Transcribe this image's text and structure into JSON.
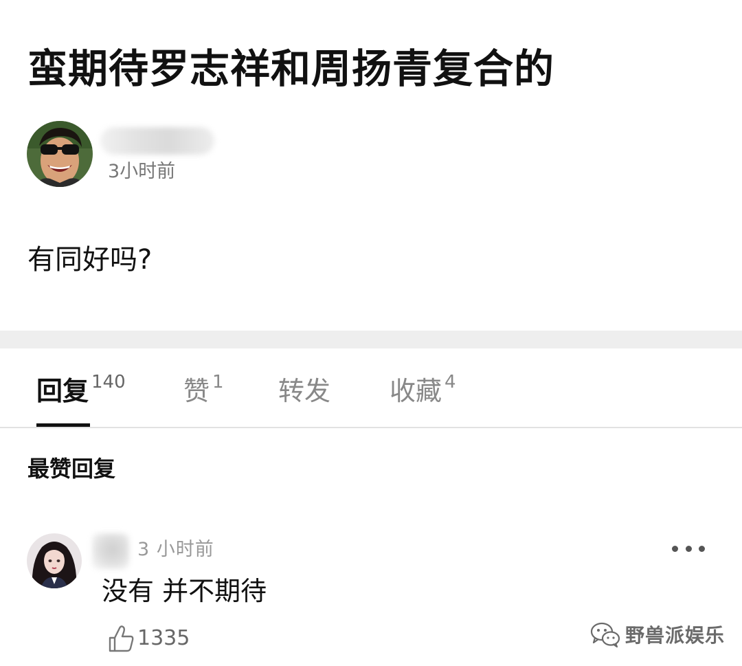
{
  "post": {
    "title": "蛮期待罗志祥和周扬青复合的",
    "author_time": "3小时前",
    "body": "有同好吗?"
  },
  "tabs": [
    {
      "label": "回复",
      "count": "140",
      "active": true
    },
    {
      "label": "赞",
      "count": "1",
      "active": false
    },
    {
      "label": "转发",
      "count": "",
      "active": false
    },
    {
      "label": "收藏",
      "count": "4",
      "active": false
    }
  ],
  "section": {
    "heading": "最赞回复"
  },
  "comment": {
    "time": "3 小时前",
    "text": "没有 并不期待",
    "likes": "1335"
  },
  "watermark": {
    "text": "野兽派娱乐",
    "icon": "wechat-icon"
  },
  "colors": {
    "divider": "#eeeeee",
    "active_tab": "#111111",
    "muted_text": "#888888"
  }
}
